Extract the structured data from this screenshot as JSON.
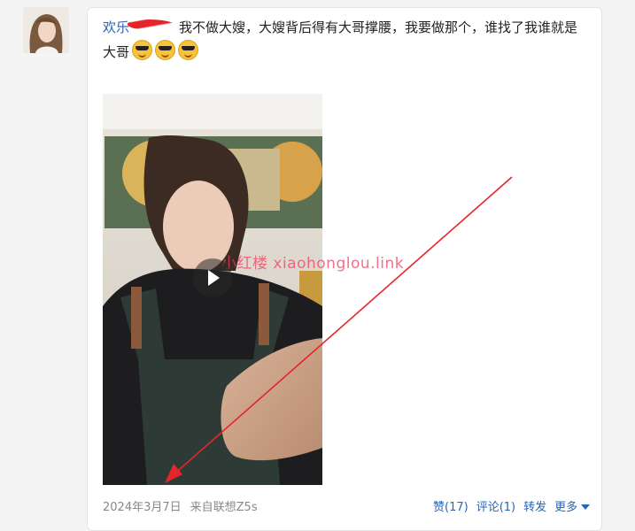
{
  "post": {
    "author": "欢乐",
    "text": "我不做大嫂，大嫂背后得有大哥撑腰，我要做那个，谁找了我谁就是大哥",
    "emojis": [
      "sunglasses-emoji",
      "sunglasses-emoji",
      "sunglasses-emoji"
    ]
  },
  "video": {
    "watermark": "小红楼  xiaohonglou.link"
  },
  "meta": {
    "date": "2024年3月7日",
    "source": "来自联想Z5s"
  },
  "actions": {
    "like": "赞(17)",
    "comment": "评论(1)",
    "repost": "转发",
    "more": "更多"
  },
  "colors": {
    "link": "#2a64b4",
    "annotation_arrow": "#e4262a"
  }
}
